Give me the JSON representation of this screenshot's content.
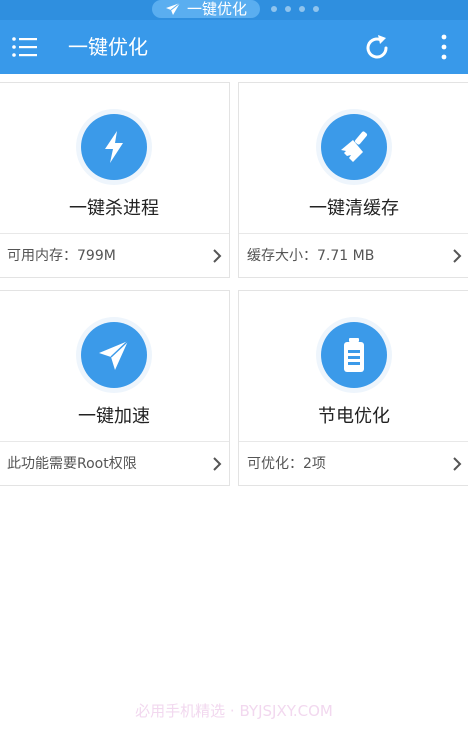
{
  "status_bar": {
    "pill_label": "一键优化"
  },
  "app_bar": {
    "title": "一键优化",
    "menu_icon": "hamburger-icon",
    "refresh_icon": "refresh-icon",
    "more_icon": "more-vertical-icon"
  },
  "cards": [
    {
      "icon": "lightning-icon",
      "title": "一键杀进程",
      "footer": "可用内存：799M"
    },
    {
      "icon": "broom-icon",
      "title": "一键清缓存",
      "footer": "缓存大小：7.71 MB"
    },
    {
      "icon": "paper-plane-icon",
      "title": "一键加速",
      "footer": "此功能需要Root权限"
    },
    {
      "icon": "battery-icon",
      "title": "节电优化",
      "footer": "可优化：2项"
    }
  ],
  "watermark": "必用手机精选 · BYJSJXY.COM",
  "colors": {
    "primary": "#3899ea",
    "status_bar": "#2f8fdf",
    "icon_circle": "#3b9ae9",
    "text": "#222222",
    "subtext": "#555555"
  }
}
